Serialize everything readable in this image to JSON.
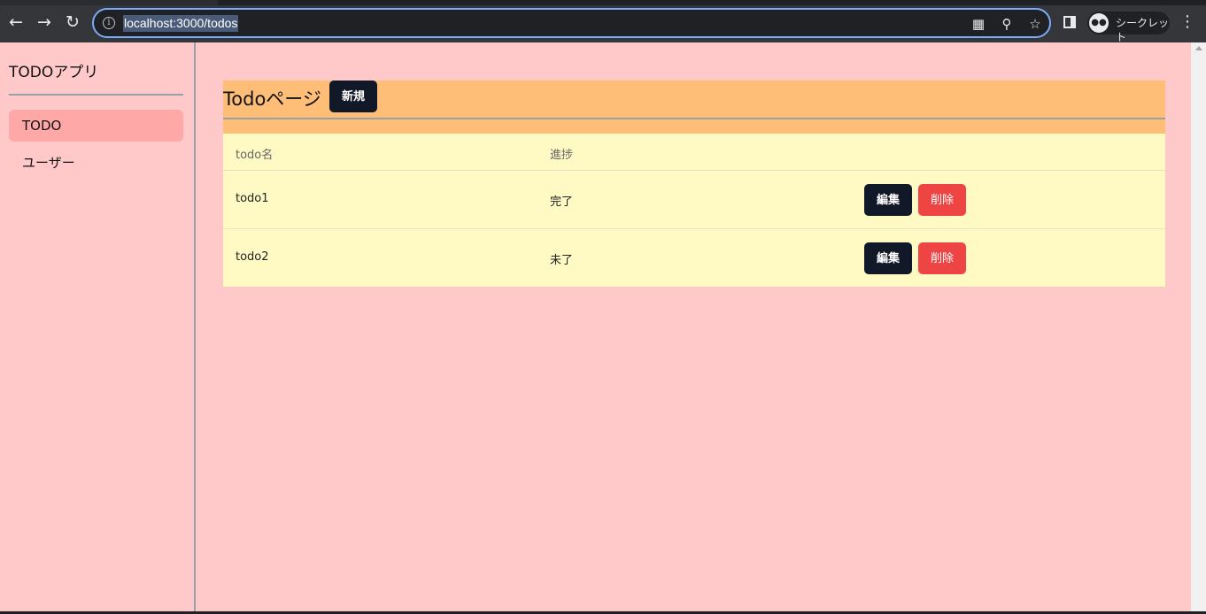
{
  "browser": {
    "url": "localhost:3000/todos",
    "profile_label": "シークレット",
    "icons": {
      "back": "arrow-left-icon",
      "forward": "arrow-right-icon",
      "reload": "reload-icon",
      "info": "info-icon",
      "qr": "qr-code-icon",
      "zoom": "zoom-out-icon",
      "bookmark": "star-icon",
      "side_panel": "side-panel-icon",
      "incognito": "incognito-icon",
      "menu": "kebab-menu-icon"
    }
  },
  "sidebar": {
    "app_title": "TODOアプリ",
    "items": [
      {
        "label": "TODO",
        "active": true
      },
      {
        "label": "ユーザー",
        "active": false
      }
    ]
  },
  "page": {
    "title": "Todoページ",
    "new_button": "新規"
  },
  "table": {
    "headers": [
      "todo名",
      "進捗"
    ],
    "rows": [
      {
        "name": "todo1",
        "status": "完了",
        "edit": "編集",
        "delete": "削除"
      },
      {
        "name": "todo2",
        "status": "未了",
        "edit": "編集",
        "delete": "削除"
      }
    ]
  },
  "colors": {
    "page_bg": "#ffc9c9",
    "active_item": "#ffa8a8",
    "header_bg": "#ffbe78",
    "table_bg": "#fff9c4",
    "primary_button": "#111827",
    "danger_button": "#ef4444"
  }
}
